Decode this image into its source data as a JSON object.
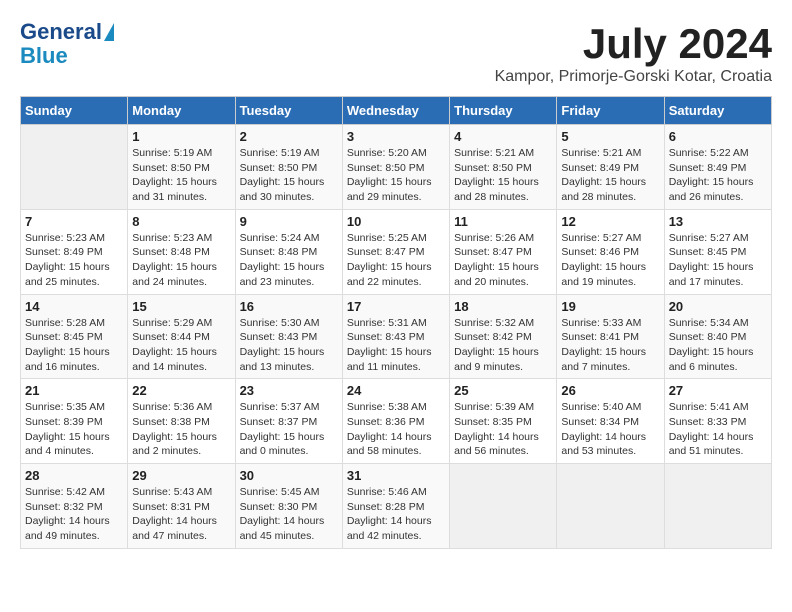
{
  "header": {
    "logo_line1": "General",
    "logo_line2": "Blue",
    "month": "July 2024",
    "location": "Kampor, Primorje-Gorski Kotar, Croatia"
  },
  "days_of_week": [
    "Sunday",
    "Monday",
    "Tuesday",
    "Wednesday",
    "Thursday",
    "Friday",
    "Saturday"
  ],
  "weeks": [
    [
      {
        "day": "",
        "info": ""
      },
      {
        "day": "1",
        "info": "Sunrise: 5:19 AM\nSunset: 8:50 PM\nDaylight: 15 hours\nand 31 minutes."
      },
      {
        "day": "2",
        "info": "Sunrise: 5:19 AM\nSunset: 8:50 PM\nDaylight: 15 hours\nand 30 minutes."
      },
      {
        "day": "3",
        "info": "Sunrise: 5:20 AM\nSunset: 8:50 PM\nDaylight: 15 hours\nand 29 minutes."
      },
      {
        "day": "4",
        "info": "Sunrise: 5:21 AM\nSunset: 8:50 PM\nDaylight: 15 hours\nand 28 minutes."
      },
      {
        "day": "5",
        "info": "Sunrise: 5:21 AM\nSunset: 8:49 PM\nDaylight: 15 hours\nand 28 minutes."
      },
      {
        "day": "6",
        "info": "Sunrise: 5:22 AM\nSunset: 8:49 PM\nDaylight: 15 hours\nand 26 minutes."
      }
    ],
    [
      {
        "day": "7",
        "info": "Sunrise: 5:23 AM\nSunset: 8:49 PM\nDaylight: 15 hours\nand 25 minutes."
      },
      {
        "day": "8",
        "info": "Sunrise: 5:23 AM\nSunset: 8:48 PM\nDaylight: 15 hours\nand 24 minutes."
      },
      {
        "day": "9",
        "info": "Sunrise: 5:24 AM\nSunset: 8:48 PM\nDaylight: 15 hours\nand 23 minutes."
      },
      {
        "day": "10",
        "info": "Sunrise: 5:25 AM\nSunset: 8:47 PM\nDaylight: 15 hours\nand 22 minutes."
      },
      {
        "day": "11",
        "info": "Sunrise: 5:26 AM\nSunset: 8:47 PM\nDaylight: 15 hours\nand 20 minutes."
      },
      {
        "day": "12",
        "info": "Sunrise: 5:27 AM\nSunset: 8:46 PM\nDaylight: 15 hours\nand 19 minutes."
      },
      {
        "day": "13",
        "info": "Sunrise: 5:27 AM\nSunset: 8:45 PM\nDaylight: 15 hours\nand 17 minutes."
      }
    ],
    [
      {
        "day": "14",
        "info": "Sunrise: 5:28 AM\nSunset: 8:45 PM\nDaylight: 15 hours\nand 16 minutes."
      },
      {
        "day": "15",
        "info": "Sunrise: 5:29 AM\nSunset: 8:44 PM\nDaylight: 15 hours\nand 14 minutes."
      },
      {
        "day": "16",
        "info": "Sunrise: 5:30 AM\nSunset: 8:43 PM\nDaylight: 15 hours\nand 13 minutes."
      },
      {
        "day": "17",
        "info": "Sunrise: 5:31 AM\nSunset: 8:43 PM\nDaylight: 15 hours\nand 11 minutes."
      },
      {
        "day": "18",
        "info": "Sunrise: 5:32 AM\nSunset: 8:42 PM\nDaylight: 15 hours\nand 9 minutes."
      },
      {
        "day": "19",
        "info": "Sunrise: 5:33 AM\nSunset: 8:41 PM\nDaylight: 15 hours\nand 7 minutes."
      },
      {
        "day": "20",
        "info": "Sunrise: 5:34 AM\nSunset: 8:40 PM\nDaylight: 15 hours\nand 6 minutes."
      }
    ],
    [
      {
        "day": "21",
        "info": "Sunrise: 5:35 AM\nSunset: 8:39 PM\nDaylight: 15 hours\nand 4 minutes."
      },
      {
        "day": "22",
        "info": "Sunrise: 5:36 AM\nSunset: 8:38 PM\nDaylight: 15 hours\nand 2 minutes."
      },
      {
        "day": "23",
        "info": "Sunrise: 5:37 AM\nSunset: 8:37 PM\nDaylight: 15 hours\nand 0 minutes."
      },
      {
        "day": "24",
        "info": "Sunrise: 5:38 AM\nSunset: 8:36 PM\nDaylight: 14 hours\nand 58 minutes."
      },
      {
        "day": "25",
        "info": "Sunrise: 5:39 AM\nSunset: 8:35 PM\nDaylight: 14 hours\nand 56 minutes."
      },
      {
        "day": "26",
        "info": "Sunrise: 5:40 AM\nSunset: 8:34 PM\nDaylight: 14 hours\nand 53 minutes."
      },
      {
        "day": "27",
        "info": "Sunrise: 5:41 AM\nSunset: 8:33 PM\nDaylight: 14 hours\nand 51 minutes."
      }
    ],
    [
      {
        "day": "28",
        "info": "Sunrise: 5:42 AM\nSunset: 8:32 PM\nDaylight: 14 hours\nand 49 minutes."
      },
      {
        "day": "29",
        "info": "Sunrise: 5:43 AM\nSunset: 8:31 PM\nDaylight: 14 hours\nand 47 minutes."
      },
      {
        "day": "30",
        "info": "Sunrise: 5:45 AM\nSunset: 8:30 PM\nDaylight: 14 hours\nand 45 minutes."
      },
      {
        "day": "31",
        "info": "Sunrise: 5:46 AM\nSunset: 8:28 PM\nDaylight: 14 hours\nand 42 minutes."
      },
      {
        "day": "",
        "info": ""
      },
      {
        "day": "",
        "info": ""
      },
      {
        "day": "",
        "info": ""
      }
    ]
  ]
}
